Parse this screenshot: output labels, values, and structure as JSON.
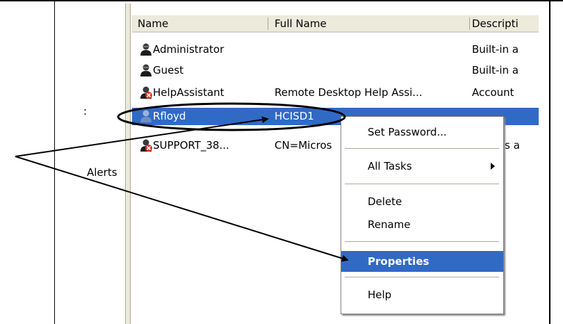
{
  "left_pane": {
    "colon": ":",
    "alerts_label": "Alerts"
  },
  "columns": [
    {
      "label": "Name"
    },
    {
      "label": "Full Name"
    },
    {
      "label": "Descripti"
    }
  ],
  "rows": [
    {
      "name": "Administrator",
      "full_name": "",
      "description": "Built-in a",
      "disabled": false
    },
    {
      "name": "Guest",
      "full_name": "",
      "description": "Built-in a",
      "disabled": false
    },
    {
      "name": "HelpAssistant",
      "full_name": "Remote Desktop Help Assi...",
      "description": "Account",
      "disabled": true
    },
    {
      "name": "Rfloyd",
      "full_name": "HCISD1",
      "description": "",
      "disabled": false,
      "selected": true
    },
    {
      "name": "SUPPORT_38...",
      "full_name": "CN=Micros",
      "description": "is a",
      "disabled": true
    }
  ],
  "context_menu": {
    "items": [
      "Set Password...",
      "All Tasks",
      "Delete",
      "Rename",
      "Properties",
      "Help"
    ],
    "highlighted": "Properties"
  },
  "colors": {
    "selection": "#316ac5",
    "header_bg": "#ebeadb",
    "annotation": "#000000"
  }
}
